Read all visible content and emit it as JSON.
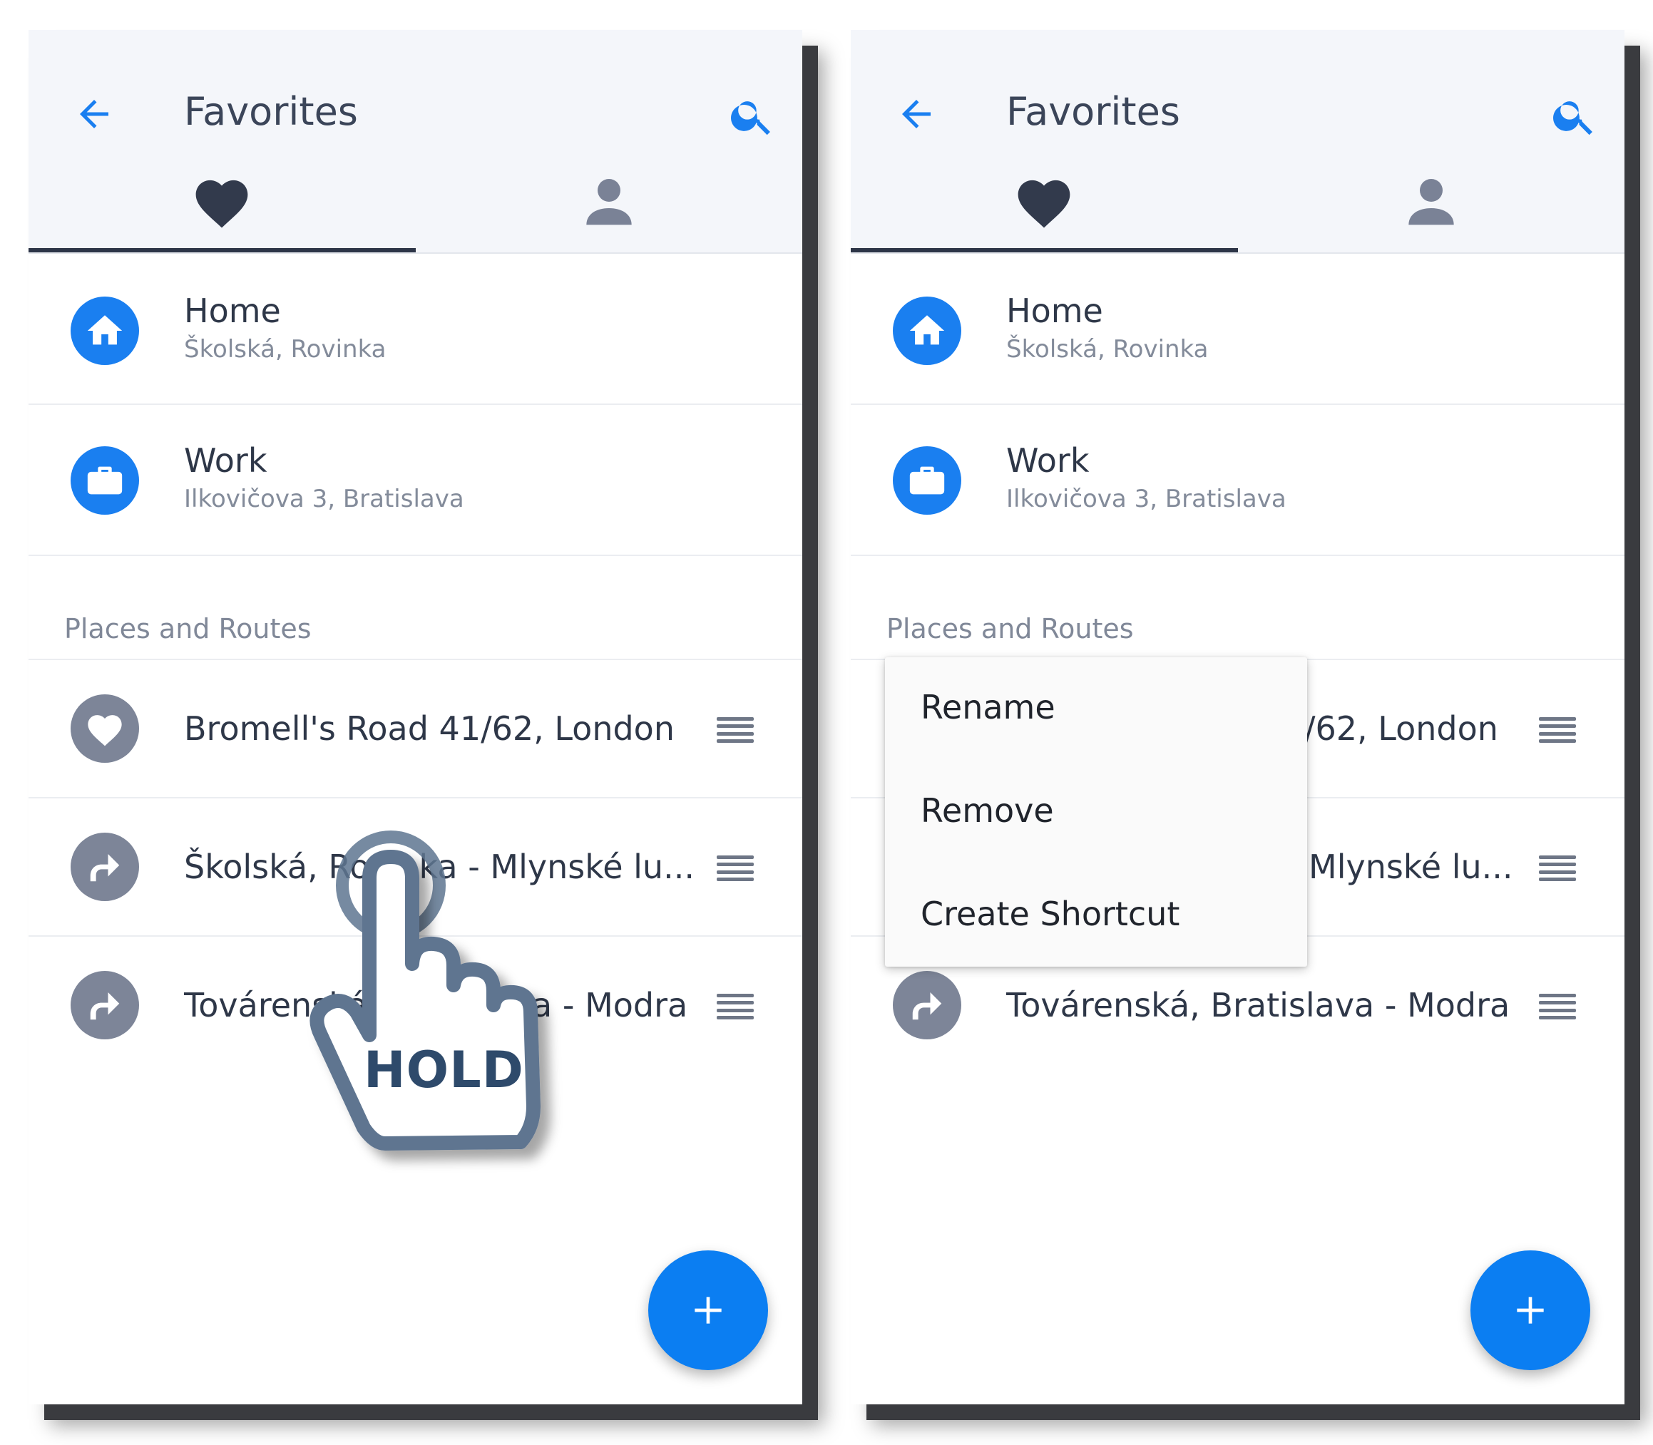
{
  "appbar": {
    "title": "Favorites",
    "back_icon": "arrow-left-icon",
    "search_icon": "search-icon"
  },
  "tabs": [
    {
      "icon": "heart-icon",
      "selected": true
    },
    {
      "icon": "person-icon",
      "selected": false
    }
  ],
  "fixed_places": [
    {
      "title": "Home",
      "subtitle": "Školská, Rovinka",
      "icon": "home-icon"
    },
    {
      "title": "Work",
      "subtitle": "Ilkovičova 3, Bratislava",
      "icon": "briefcase-icon"
    }
  ],
  "section_label": "Places and Routes",
  "favorites": [
    {
      "title": "Bromell's Road 41/62, London",
      "icon": "heart-icon"
    },
    {
      "title": "Školská, Rovinka - Mlynské lu...",
      "icon": "route-arrow-icon"
    },
    {
      "title": "Továrenská, Bratislava - Modra",
      "icon": "route-arrow-icon"
    }
  ],
  "right_partial": {
    "fav0": "/62, London",
    "fav1": "Mlynské lu..."
  },
  "gesture": {
    "label": "HOLD"
  },
  "context_menu": [
    "Rename",
    "Remove",
    "Create Shortcut"
  ],
  "fab": {
    "icon": "plus-icon"
  },
  "colors": {
    "accent": "#0b7ef2",
    "header_bg": "#f4f6fa",
    "text": "#2e3748",
    "muted": "#838b9a",
    "gray_icon": "#7d8598"
  }
}
